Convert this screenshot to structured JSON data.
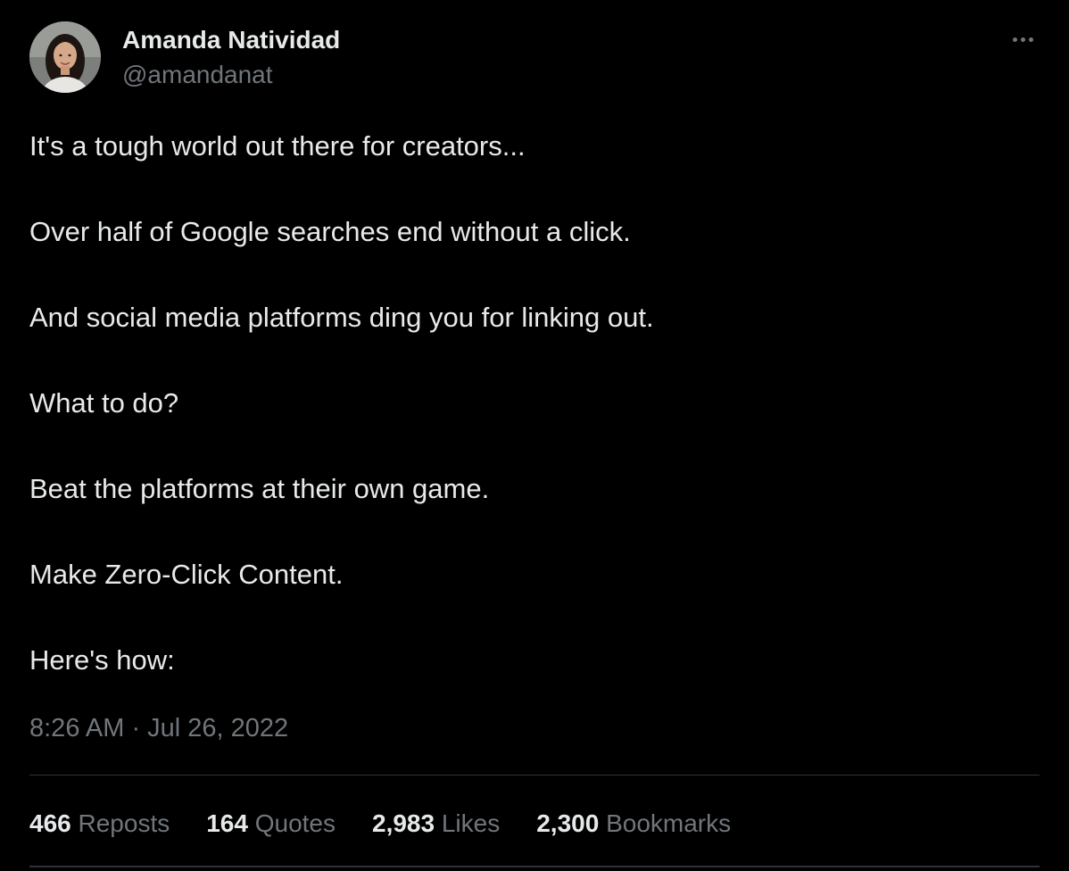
{
  "author": {
    "name": "Amanda Natividad",
    "handle": "@amandanat"
  },
  "tweet": {
    "lines": [
      "It's a tough world out there for creators...",
      "Over half of Google searches end without a click.",
      "And social media platforms ding you for linking out.",
      "What to do?",
      "Beat the platforms at their own game.",
      "Make Zero-Click Content.",
      "Here's how:"
    ],
    "timestamp": "8:26 AM · Jul 26, 2022"
  },
  "stats": {
    "reposts": {
      "count": "466",
      "label": "Reposts"
    },
    "quotes": {
      "count": "164",
      "label": "Quotes"
    },
    "likes": {
      "count": "2,983",
      "label": "Likes"
    },
    "bookmarks": {
      "count": "2,300",
      "label": "Bookmarks"
    }
  },
  "colors": {
    "background": "#000000",
    "primary_text": "#e7e9ea",
    "secondary_text": "#71767b",
    "divider": "#2f3336"
  },
  "icons": {
    "more": "more-horizontal-icon"
  }
}
